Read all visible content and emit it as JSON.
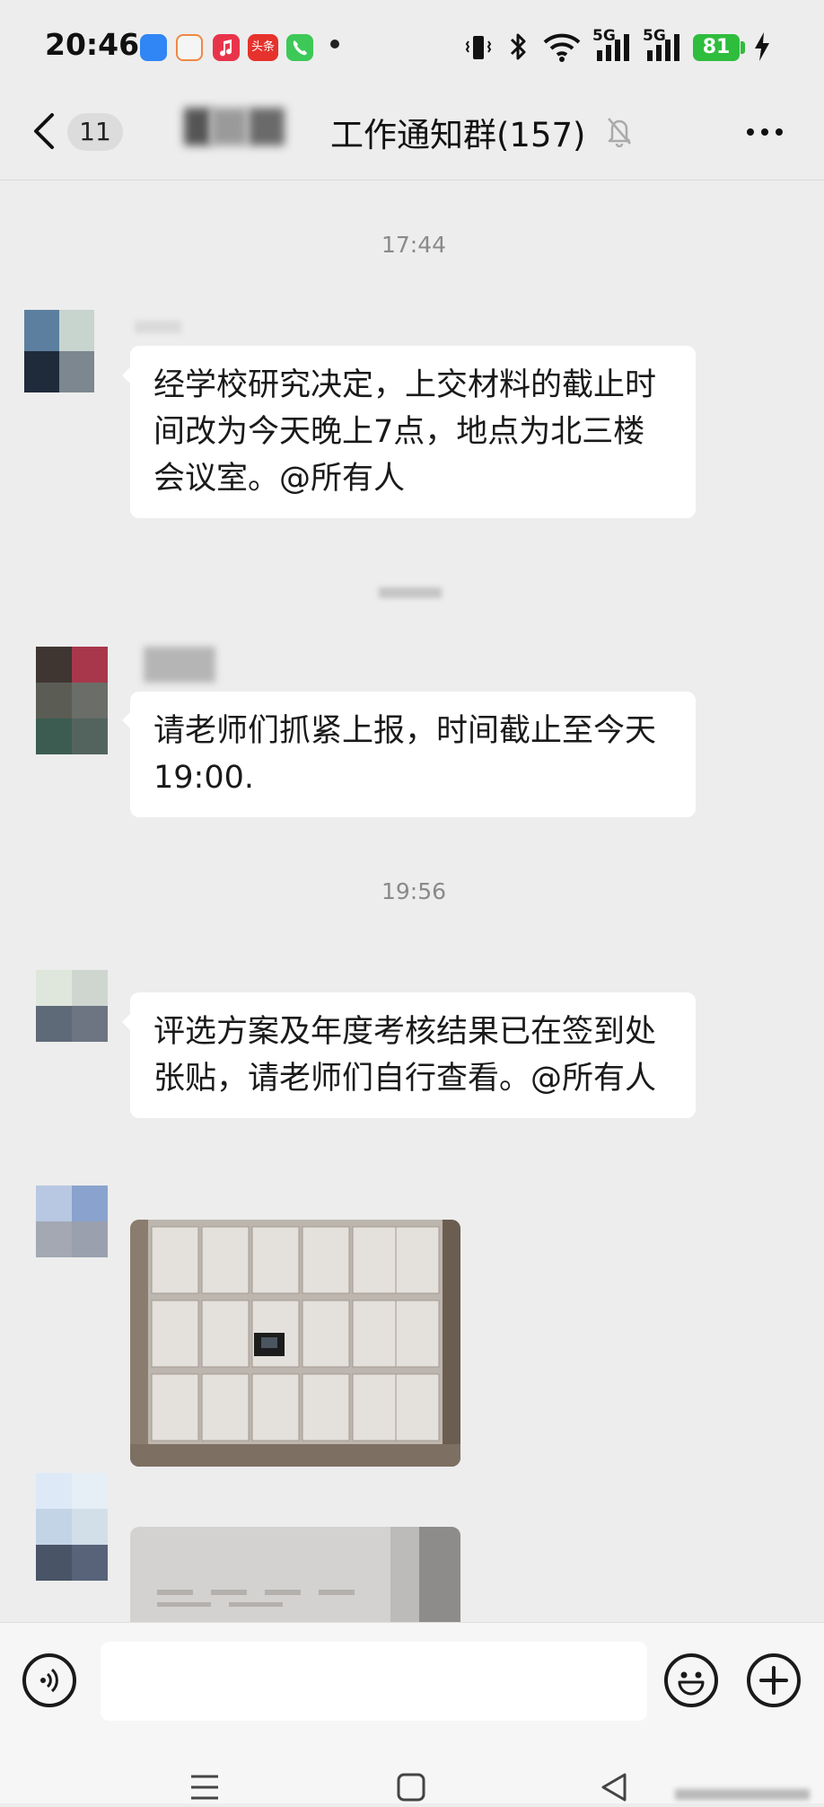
{
  "status_bar": {
    "time": "20:46",
    "app_icons": [
      "browser-icon",
      "photos-icon",
      "music-icon",
      "toutiao-icon",
      "phone-icon"
    ],
    "toutiao_label": "头条",
    "network_1": "5G",
    "network_2": "5G",
    "battery_level": "81",
    "accent": "#2fbd3e"
  },
  "header": {
    "unread_count": "11",
    "chat_title": "工作通知群(157)"
  },
  "chat": {
    "time_1": "17:44",
    "message_1": "经学校研究决定，上交材料的截止时间改为今天晚上7点，地点为北三楼会议室。@所有人",
    "message_2": "请老师们抓紧上报，时间截止至今天19:00.",
    "time_2": "19:56",
    "message_3": "评选方案及年度考核结果已在签到处张贴，请老师们自行查看。@所有人"
  },
  "input_bar": {
    "icons": [
      "voice-icon",
      "emoji-icon",
      "plus-icon"
    ]
  },
  "nav_bar": {
    "icons": [
      "menu-icon",
      "home-icon",
      "back-icon"
    ]
  }
}
